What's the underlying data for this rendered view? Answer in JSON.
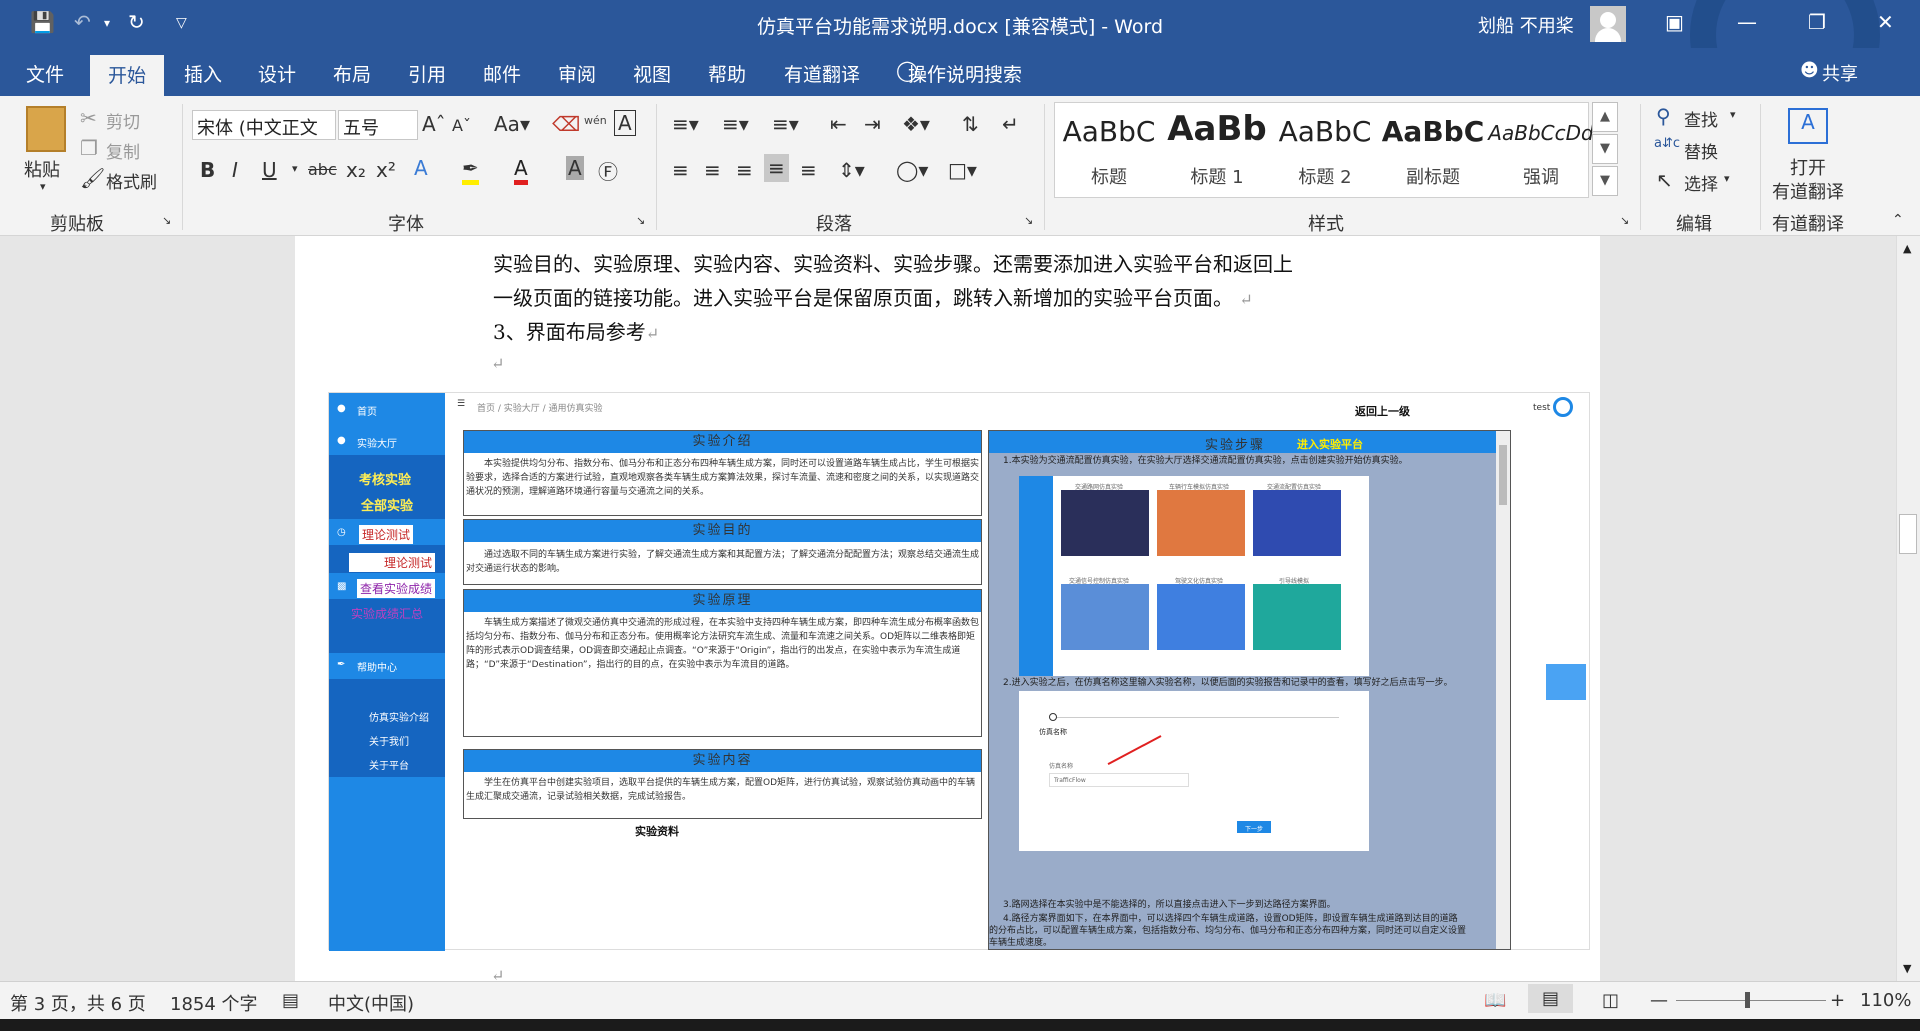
{
  "window": {
    "title": "仿真平台功能需求说明.docx [兼容模式] - Word",
    "user": "划船 不用桨"
  },
  "tabs": [
    "文件",
    "开始",
    "插入",
    "设计",
    "布局",
    "引用",
    "邮件",
    "审阅",
    "视图",
    "帮助",
    "有道翻译"
  ],
  "tell_me": "操作说明搜索",
  "share": "共享",
  "ribbon": {
    "clipboard": {
      "paste": "粘贴",
      "cut": "剪切",
      "copy": "复制",
      "format_painter": "格式刷",
      "label": "剪贴板"
    },
    "font": {
      "name": "宋体 (中文正文",
      "size": "五号",
      "label": "字体"
    },
    "paragraph": {
      "label": "段落"
    },
    "styles": {
      "label": "样式",
      "items": [
        {
          "preview": "AaBbC",
          "name": "标题"
        },
        {
          "preview": "AaBb",
          "name": "标题 1"
        },
        {
          "preview": "AaBbC",
          "name": "标题 2"
        },
        {
          "preview": "AaBbC",
          "name": "副标题"
        },
        {
          "preview": "AaBbCcDd",
          "name": "强调"
        }
      ]
    },
    "editing": {
      "find": "查找",
      "replace": "替换",
      "select": "选择",
      "label": "编辑"
    },
    "youdao": {
      "open_line1": "打开",
      "open_line2": "有道翻译",
      "label": "有道翻译"
    }
  },
  "doc": {
    "line1": "实验目的、实验原理、实验内容、实验资料、实验步骤。还需要添加进入实验平台和返回上",
    "line2": "一级页面的链接功能。进入实验平台是保留原页面，跳转入新增加的实验平台页面。",
    "line3": "3、界面布局参考"
  },
  "shot": {
    "nav": {
      "home": "首页",
      "hall": "实验大厅",
      "assess": "考核实验",
      "all": "全部实验",
      "theory": "理论测试",
      "theory2": "理论测试",
      "results": "查看实验成绩",
      "summary": "实验成绩汇总",
      "help": "帮助中心",
      "intro": "仿真实验介绍",
      "about": "关于我们",
      "platform": "关于平台"
    },
    "breadcrumb": "首页 / 实验大厅 / 通用仿真实验",
    "back": "返回上一级",
    "user": "test",
    "intro_title": "实验介绍",
    "intro_text": "本实验提供均匀分布、指数分布、伽马分布和正态分布四种车辆生成方案，同时还可以设置道路车辆生成占比，学生可根据实验要求，选择合适的方案进行试验，直观地观察各类车辆生成方案算法效果，探讨车流量、流速和密度之间的关系，以实现道路交通状况的预测，理解道路环境通行容量与交通流之间的关系。",
    "purpose_title": "实验目的",
    "purpose_text": "通过选取不同的车辆生成方案进行实验，了解交通流生成方案和其配置方法；了解交通流分配配置方法；观察总结交通流生成对交通运行状态的影响。",
    "principle_title": "实验原理",
    "principle_text": "车辆生成方案描述了微观交通仿真中交通流的形成过程，在本实验中支持四种车辆生成方案，即四种车流生成分布概率函数包括均匀分布、指数分布、伽马分布和正态分布。使用概率论方法研究车流生成、流量和车流速之间关系。OD矩阵以二维表格即矩阵的形式表示OD调查结果，OD调查即交通起止点调查。“O”来源于“Origin”，指出行的出发点，在实验中表示为车流生成道路；“D”来源于“Destination”，指出行的目的点，在实验中表示为车流目的道路。",
    "content_title": "实验内容",
    "content_text": "学生在仿真平台中创建实验项目，选取平台提供的车辆生成方案，配置OD矩阵，进行仿真试验，观察试验仿真动画中的车辆生成汇聚成交通流，记录试验相关数据，完成试验报告。",
    "materials": "实验资料",
    "steps_title": "实验步骤",
    "enter": "进入实验平台",
    "step1": "1.本实验为交通流配置仿真实验，在实验大厅选择交通流配置仿真实验，点击创建实验开始仿真实验。",
    "step2": "2.进入实验之后，在仿真名称这里输入实验名称，以便后面的实验报告和记录中的查看，填写好之后点击写一步。",
    "step3": "3.路网选择在本实验中是不能选择的，所以直接点击进入下一步到达路径方案界面。",
    "step4a": "4.路径方案界面如下，在本界面中，可以选择四个车辆生成道路，设置OD矩阵，即设置车辆生成道路到达目的道路",
    "step4b": "的分布占比，可以配置车辆生成方案，包括指数分布、均匀分布、伽马分布和正态分布四种方案，同时还可以自定义设置",
    "step4c": "车辆生成速度。",
    "sim_name": "仿真名称",
    "sim_input": "TrafficFlow",
    "next_btn": "下一步",
    "tiles": [
      "交通路网仿真实验",
      "车辆行车模拟仿真实验",
      "交通流配置仿真实验",
      "交通信号控制仿真实验",
      "驾驶文化仿真实验",
      "引导线模拟"
    ]
  },
  "status": {
    "page": "第 3 页，共 6 页",
    "words": "1854 个字",
    "lang": "中文(中国)",
    "zoom": "110%"
  },
  "colors": {
    "word_blue": "#2b579a",
    "nav_blue": "#1e88e5"
  }
}
